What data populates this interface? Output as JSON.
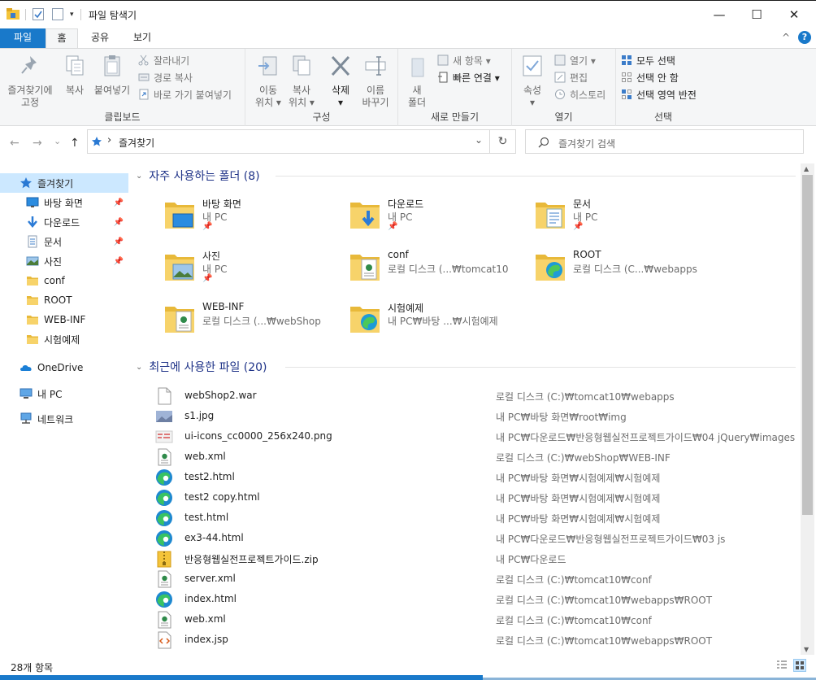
{
  "window": {
    "title": "파일 탐색기",
    "controls": {
      "minimize": "—",
      "maximize": "☐",
      "close": "✕"
    }
  },
  "ribbon_tabs": {
    "file": "파일",
    "home": "홈",
    "share": "공유",
    "view": "보기",
    "collapse": "^",
    "help": "?"
  },
  "ribbon": {
    "clipboard": {
      "name": "클립보드",
      "pin_quick": "즐겨찾기에\n고정",
      "copy": "복사",
      "paste": "붙여넣기",
      "cut": "잘라내기",
      "copy_path": "경로 복사",
      "paste_shortcut": "바로 가기 붙여넣기"
    },
    "organize": {
      "name": "구성",
      "move_to": "이동\n위치 ▾",
      "copy_to": "복사\n위치 ▾",
      "delete": "삭제\n▾",
      "rename": "이름\n바꾸기"
    },
    "new": {
      "name": "새로 만들기",
      "new_folder": "새\n폴더",
      "new_item": "새 항목 ▾",
      "easy_access": "빠른 연결 ▾"
    },
    "open": {
      "name": "열기",
      "properties": "속성\n▾",
      "open": "열기 ▾",
      "edit": "편집",
      "history": "히스토리"
    },
    "select": {
      "name": "선택",
      "select_all": "모두 선택",
      "select_none": "선택 안 함",
      "invert": "선택 영역 반전"
    }
  },
  "address": {
    "back": "←",
    "forward": "→",
    "recent": "⌄",
    "up": "↑",
    "path_sep": "›",
    "path": "즐겨찾기",
    "dropdown": "⌄",
    "refresh": "↻",
    "search_placeholder": "즐겨찾기 검색"
  },
  "nav": {
    "items": [
      {
        "label": "즐겨찾기",
        "icon": "star-icon",
        "selected": true,
        "pinned": false
      },
      {
        "label": "바탕 화면",
        "icon": "desktop-icon",
        "pinned": true
      },
      {
        "label": "다운로드",
        "icon": "download-icon",
        "pinned": true
      },
      {
        "label": "문서",
        "icon": "document-icon",
        "pinned": true
      },
      {
        "label": "사진",
        "icon": "picture-icon",
        "pinned": true
      },
      {
        "label": "conf",
        "icon": "folder-icon",
        "pinned": false
      },
      {
        "label": "ROOT",
        "icon": "folder-icon",
        "pinned": false
      },
      {
        "label": "WEB-INF",
        "icon": "folder-icon",
        "pinned": false
      },
      {
        "label": "시험예제",
        "icon": "folder-icon",
        "pinned": false
      }
    ],
    "onedrive": "OneDrive",
    "this_pc": "내 PC",
    "network": "네트워크",
    "pin_glyph": "📌"
  },
  "frequent": {
    "header": "자주 사용하는 폴더 (8)",
    "chevron": "⌄",
    "folders": [
      {
        "name": "바탕 화면",
        "sub": "내 PC",
        "pinned": true,
        "icon": "desktop-folder-icon"
      },
      {
        "name": "다운로드",
        "sub": "내 PC",
        "pinned": true,
        "icon": "download-folder-icon"
      },
      {
        "name": "문서",
        "sub": "내 PC",
        "pinned": true,
        "icon": "document-folder-icon"
      },
      {
        "name": "사진",
        "sub": "내 PC",
        "pinned": true,
        "icon": "picture-folder-icon"
      },
      {
        "name": "conf",
        "sub": "로컬 디스크 (...₩tomcat10",
        "pinned": false,
        "icon": "xml-folder-icon"
      },
      {
        "name": "ROOT",
        "sub": "로컬 디스크 (C...₩webapps",
        "pinned": false,
        "icon": "edge-folder-icon"
      },
      {
        "name": "WEB-INF",
        "sub": "로컬 디스크 (...₩webShop",
        "pinned": false,
        "icon": "xml-folder-icon"
      },
      {
        "name": "시험예제",
        "sub": "내 PC₩바탕 ...₩시험예제",
        "pinned": false,
        "icon": "edge-folder-icon"
      }
    ]
  },
  "recent": {
    "header": "최근에 사용한 파일 (20)",
    "chevron": "⌄",
    "files": [
      {
        "name": "webShop2.war",
        "path": "로컬 디스크 (C:)₩tomcat10₩webapps",
        "icon": "blank-file-icon"
      },
      {
        "name": "s1.jpg",
        "path": "내 PC₩바탕 화면₩root₩img",
        "icon": "image-file-icon"
      },
      {
        "name": "ui-icons_cc0000_256x240.png",
        "path": "내 PC₩다운로드₩반응형웹실전프로젝트가이드₩04 jQuery₩images",
        "icon": "png-file-icon"
      },
      {
        "name": "web.xml",
        "path": "로컬 디스크 (C:)₩webShop₩WEB-INF",
        "icon": "xml-file-icon"
      },
      {
        "name": "test2.html",
        "path": "내 PC₩바탕 화면₩시험예제₩시험예제",
        "icon": "edge-icon"
      },
      {
        "name": "test2 copy.html",
        "path": "내 PC₩바탕 화면₩시험예제₩시험예제",
        "icon": "edge-icon"
      },
      {
        "name": "test.html",
        "path": "내 PC₩바탕 화면₩시험예제₩시험예제",
        "icon": "edge-icon"
      },
      {
        "name": "ex3-44.html",
        "path": "내 PC₩다운로드₩반응형웹실전프로젝트가이드₩03 js",
        "icon": "edge-icon"
      },
      {
        "name": "반응형웹실전프로젝트가이드.zip",
        "path": "내 PC₩다운로드",
        "icon": "zip-file-icon"
      },
      {
        "name": "server.xml",
        "path": "로컬 디스크 (C:)₩tomcat10₩conf",
        "icon": "xml-file-icon"
      },
      {
        "name": "index.html",
        "path": "로컬 디스크 (C:)₩tomcat10₩webapps₩ROOT",
        "icon": "edge-icon"
      },
      {
        "name": "web.xml",
        "path": "로컬 디스크 (C:)₩tomcat10₩conf",
        "icon": "xml-file-icon"
      },
      {
        "name": "index.jsp",
        "path": "로컬 디스크 (C:)₩tomcat10₩webapps₩ROOT",
        "icon": "jsp-file-icon"
      }
    ]
  },
  "status": {
    "count": "28개 항목"
  },
  "colors": {
    "accent": "#1979ca",
    "selection": "#cce8ff",
    "header_text": "#1e3287",
    "ribbon_bg": "#f5f6f7"
  }
}
